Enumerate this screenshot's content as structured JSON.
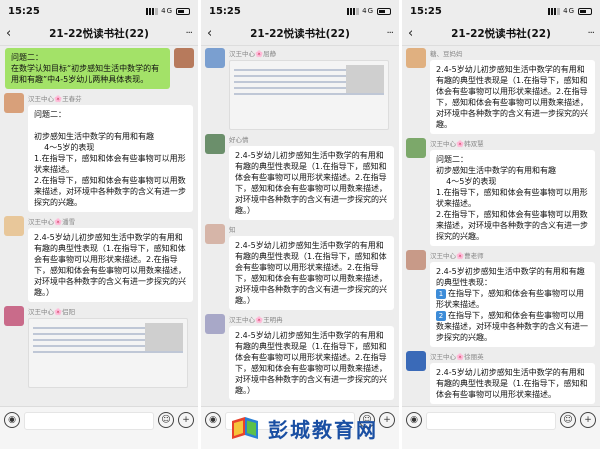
{
  "status": {
    "time": "15:25",
    "network": "4G"
  },
  "chat_title": "21-22悦读书社(22)",
  "panels": [
    {
      "messages": [
        {
          "side": "right",
          "avatar": "avme",
          "sender": "",
          "green": true,
          "text": "问题二：\n在数学认知目标“初步感知生活中数学的有用和有趣”中4-5岁幼儿两种具体表现。"
        },
        {
          "side": "left",
          "avatar": "av1",
          "sender": "汉王中心🌸王春芬",
          "text": "问题二：\n\n初步感知生活中数学的有用和有趣\n    4～5岁的表现\n1.在指导下，感知和体会有些事物可以用形状来描述。\n2.在指导下，感知和体会有些事物可以用数来描述，对环境中各种数字的含义有进一步探究的兴趣。"
        },
        {
          "side": "left",
          "avatar": "av2",
          "sender": "汉王中心🌸潘雪",
          "text": "2.4-5岁幼儿初步感知生活中数学的有用和有趣的典型性表现（1.在指导下，感知和体会有些事物可以用形状来描述。2.在指导下，感知和体会有些事物可以用数来描述，对环境中各种数字的含义有进一步探究的兴趣。）"
        },
        {
          "side": "left",
          "avatar": "av3",
          "sender": "汉王中心🌸侣阳",
          "image": true,
          "text": ""
        }
      ]
    },
    {
      "messages": [
        {
          "side": "left",
          "avatar": "av4",
          "sender": "汉王中心🌸屈静",
          "image": true,
          "text": ""
        },
        {
          "side": "left",
          "avatar": "av5",
          "sender": "好心情",
          "text": "2.4-5岁幼儿初步感知生活中数学的有用和有趣的典型性表现是（1.在指导下，感知和体会有些事物可以用形状来描述。2.在指导下，感知和体会有些事物可以用数来描述，对环境中各种数字的含义有进一步探究的兴趣。）"
        },
        {
          "side": "left",
          "avatar": "av6",
          "sender": "知",
          "text": "2.4-5岁幼儿初步感知生活中数学的有用和有趣的典型性表现（1.在指导下，感知和体会有些事物可以用形状来描述。2.在指导下，感知和体会有些事物可以用数来描述，对环境中各种数字的含义有进一步探究的兴趣。）"
        },
        {
          "side": "left",
          "avatar": "av7",
          "sender": "汉王中心🌸王明冉",
          "text": "2.4-5岁幼儿初步感知生活中数学的有用和有趣的典型性表现是（1.在指导下，感知和体会有些事物可以用形状来描述。2.在指导下，感知和体会有些事物可以用数来描述，对环境中各种数字的含义有进一步探究的兴趣。）"
        }
      ]
    },
    {
      "messages": [
        {
          "side": "left",
          "avatar": "av8",
          "sender": "糖、豆妈妈",
          "text": "2.4-5岁幼儿初步感知生活中数学的有用和有趣的典型性表现是（1.在指导下，感知和体会有些事物可以用形状来描述。2.在指导下，感知和体会有些事物可以用数来描述，对环境中各种数字的含义有进一步探究的兴趣。"
        },
        {
          "side": "left",
          "avatar": "av10",
          "sender": "汉王中心🌸韩双慧",
          "text": "问题二：\n初步感知生活中数学的有用和有趣\n    4～5岁的表现\n1.在指导下，感知和体会有些事物可以用形状来描述。\n2.在指导下，感知和体会有些事物可以用数来描述，对环境中各种数字的含义有进一步探究的兴趣。"
        },
        {
          "side": "left",
          "avatar": "av11",
          "sender": "汉王中心🌸曹老师",
          "numbered": true,
          "text": "2.4-5岁初步感知生活中数学的有用和有趣的典型性表现：",
          "n1": "在指导下，感知和体会有些事物可以用形状来描述。",
          "n2": "在指导下，感知和体会有些事物可以用数来描述，对环境中各种数字的含义有进一步探究的兴趣。"
        },
        {
          "side": "left",
          "avatar": "av12",
          "sender": "汉王中心🌸徐丽英",
          "text": "2.4-5岁幼儿初步感知生活中数学的有用和有趣的典型性表现是（1.在指导下，感知和体会有些事物可以用形状来描述。"
        }
      ]
    }
  ],
  "watermark": {
    "text": "彭城教育网"
  }
}
